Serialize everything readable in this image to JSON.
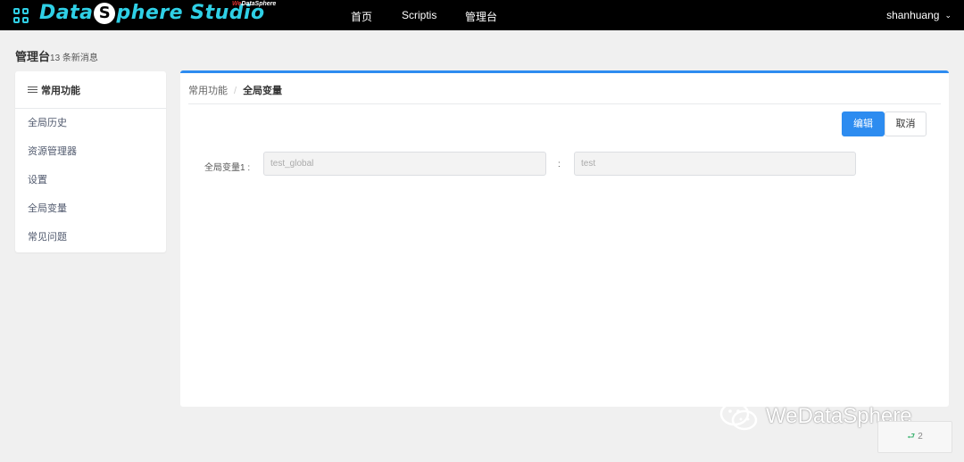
{
  "header": {
    "logo_text_before": "Data",
    "logo_s": "S",
    "logo_text_after": "phere Studio",
    "logo_badge_we": "We",
    "logo_badge_rest": "DataSphere",
    "nav": [
      "首页",
      "Scriptis",
      "管理台"
    ],
    "user": "shanhuang",
    "user_caret": "⌄"
  },
  "page": {
    "title": "管理台",
    "message_count": "13 条新消息"
  },
  "sidebar": {
    "heading": "常用功能",
    "items": [
      "全局历史",
      "资源管理器",
      "设置",
      "全局变量",
      "常见问题"
    ]
  },
  "main": {
    "breadcrumb": [
      "常用功能",
      "全局变量"
    ],
    "breadcrumb_sep": "/",
    "edit_button": "编辑",
    "cancel_button": "取消",
    "variable_label": "全局变量1 :",
    "key_value": "test_global",
    "colon": ":",
    "value_value": "test"
  },
  "watermark": "WeDataSphere",
  "page_badge": "2",
  "page_badge_icon": "⮐",
  "colors": {
    "accent": "#2d8cf0",
    "logo": "#2fd0e6",
    "topbar": "#000000"
  }
}
